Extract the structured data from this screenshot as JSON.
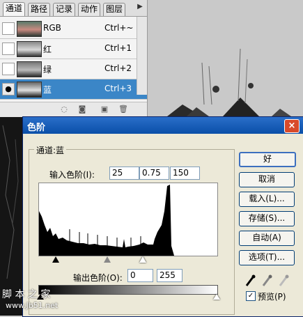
{
  "panel": {
    "tabs": [
      "通道",
      "路径",
      "记录",
      "动作",
      "图层"
    ],
    "channels": [
      {
        "name": "RGB",
        "shortcut": "Ctrl+~",
        "visible": false,
        "selected": false
      },
      {
        "name": "红",
        "shortcut": "Ctrl+1",
        "visible": false,
        "selected": false
      },
      {
        "name": "绿",
        "shortcut": "Ctrl+2",
        "visible": false,
        "selected": false
      },
      {
        "name": "蓝",
        "shortcut": "Ctrl+3",
        "visible": true,
        "selected": true
      }
    ]
  },
  "dialog": {
    "title": "色阶",
    "close_label": "×",
    "channel_label": "通道:蓝",
    "input_levels_label": "输入色阶(I):",
    "input_black": "25",
    "input_gamma": "0.75",
    "input_white": "150",
    "output_levels_label": "输出色阶(O):",
    "output_black": "0",
    "output_white": "255",
    "buttons": {
      "ok": "好",
      "cancel": "取消",
      "load": "载入(L)...",
      "save": "存储(S)...",
      "auto": "自动(A)",
      "options": "选项(T)..."
    },
    "preview_label": "预览(P)",
    "preview_checked": true
  },
  "watermark": {
    "line1": "脚 本 之 家",
    "line2": "www.Jb51.net"
  }
}
